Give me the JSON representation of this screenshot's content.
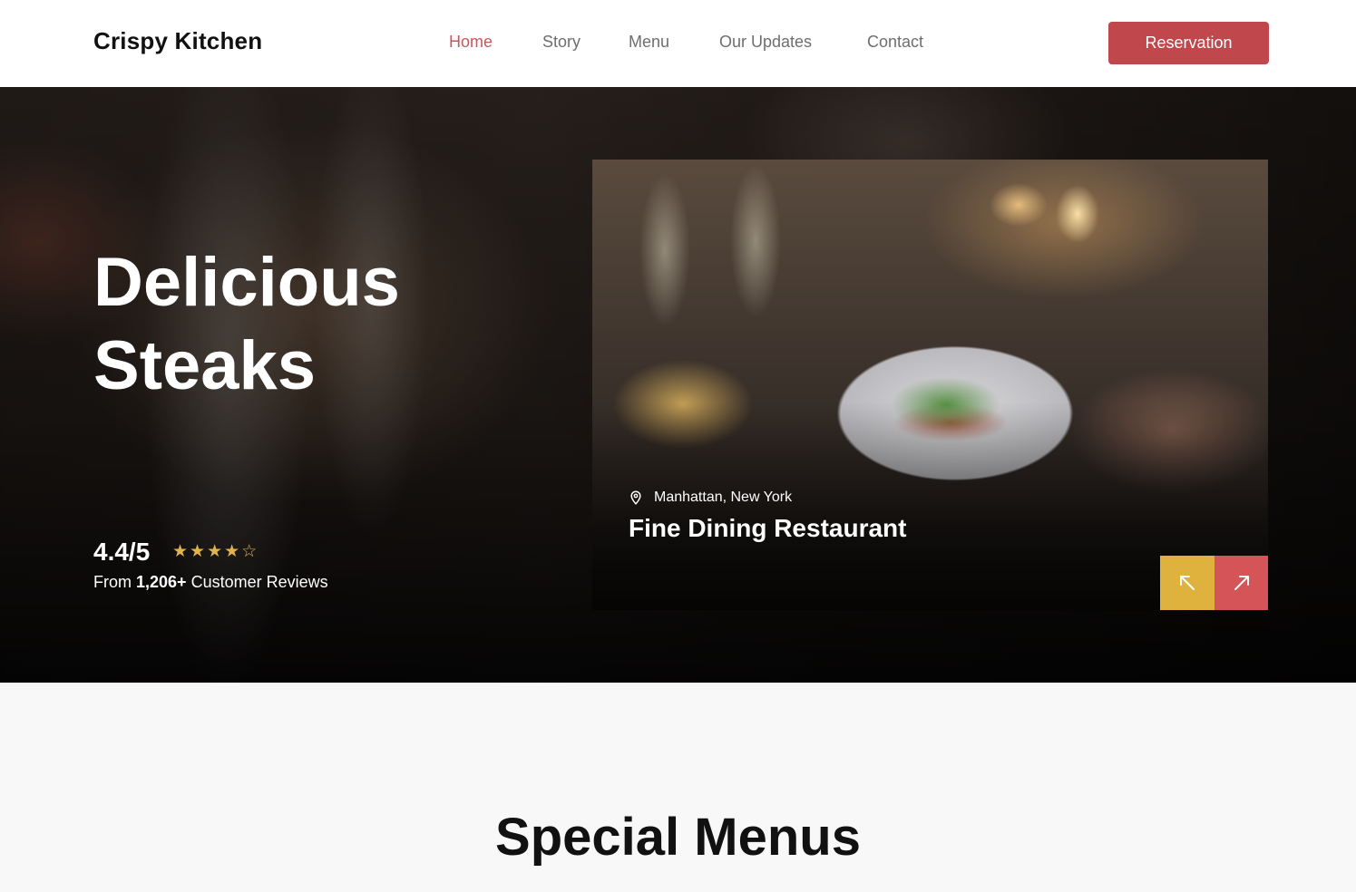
{
  "brand": {
    "name": "Crispy Kitchen"
  },
  "nav": {
    "items": [
      {
        "label": "Home",
        "active": true
      },
      {
        "label": "Story",
        "active": false
      },
      {
        "label": "Menu",
        "active": false
      },
      {
        "label": "Our Updates",
        "active": false
      },
      {
        "label": "Contact",
        "active": false
      }
    ],
    "cta_label": "Reservation"
  },
  "hero": {
    "title_line1": "Delicious",
    "title_line2": "Steaks",
    "rating": "4.4/5",
    "stars": "★★★★☆",
    "reviews_prefix": "From",
    "reviews_count": "1,206+",
    "reviews_suffix": "Customer Reviews"
  },
  "card": {
    "location": "Manhattan, New York",
    "title": "Fine Dining Restaurant",
    "prev_icon": "arrow-up-left-icon",
    "next_icon": "arrow-up-right-icon"
  },
  "specials": {
    "title": "Special Menus"
  },
  "colors": {
    "accent": "#c0474b",
    "nav_active": "#c8575b",
    "star": "#e2b34a",
    "prev_button": "#dfb23e",
    "next_button": "#d45458"
  }
}
